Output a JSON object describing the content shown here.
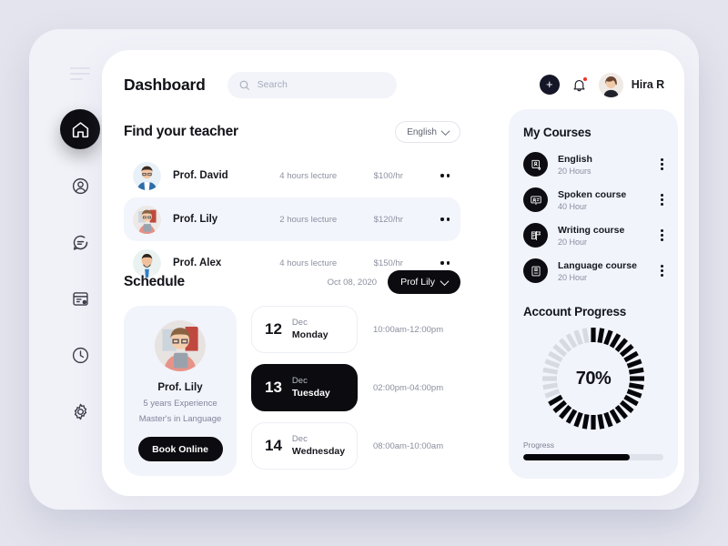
{
  "sidebar": {
    "items": [
      {
        "name": "menu-toggle",
        "icon": "hamburger-icon"
      },
      {
        "name": "home",
        "icon": "home-icon",
        "active": true
      },
      {
        "name": "profile",
        "icon": "user-icon",
        "active": false
      },
      {
        "name": "messages",
        "icon": "chat-icon",
        "active": false
      },
      {
        "name": "documents",
        "icon": "document-icon",
        "active": false
      },
      {
        "name": "history",
        "icon": "clock-icon",
        "active": false
      },
      {
        "name": "settings",
        "icon": "gear-icon",
        "active": false
      }
    ]
  },
  "header": {
    "title": "Dashboard",
    "search": {
      "placeholder": "Search",
      "value": "",
      "icon": "search-icon"
    },
    "add_button_label": "+",
    "bell_icon": "bell-icon",
    "user_name": "Hira R"
  },
  "find_teacher": {
    "title": "Find your teacher",
    "language_filter": {
      "label": "English",
      "icon": "chevron-down-icon"
    },
    "teachers": [
      {
        "name": "Prof. David",
        "hours": "4 hours lecture",
        "price": "$100/hr",
        "selected": false
      },
      {
        "name": "Prof. Lily",
        "hours": "2 hours lecture",
        "price": "$120/hr",
        "selected": true
      },
      {
        "name": "Prof. Alex",
        "hours": "4 hours lecture",
        "price": "$150/hr",
        "selected": false
      }
    ]
  },
  "schedule": {
    "title": "Schedule",
    "date": "Oct 08, 2020",
    "teacher_filter": {
      "label": "Prof Lily",
      "icon": "chevron-down-icon"
    },
    "teacher_card": {
      "name": "Prof. Lily",
      "experience": "5 years Experience",
      "degree": "Master's in Language",
      "book_label": "Book Online"
    },
    "slots": [
      {
        "day": "12",
        "month": "Dec",
        "weekday": "Monday",
        "time": "10:00am-12:00pm",
        "active": false
      },
      {
        "day": "13",
        "month": "Dec",
        "weekday": "Tuesday",
        "time": "02:00pm-04:00pm",
        "active": true
      },
      {
        "day": "14",
        "month": "Dec",
        "weekday": "Wednesday",
        "time": "08:00am-10:00am",
        "active": false
      }
    ]
  },
  "my_courses": {
    "title": "My Courses",
    "items": [
      {
        "name": "English",
        "hours": "20 Hours",
        "icon": "certificate-icon"
      },
      {
        "name": "Spoken course",
        "hours": "40 Hour",
        "icon": "presentation-icon"
      },
      {
        "name": "Writing course",
        "hours": "20 Hour",
        "icon": "book-flag-icon"
      },
      {
        "name": "Language course",
        "hours": "20 Hour",
        "icon": "bookmark-book-icon"
      }
    ]
  },
  "account_progress": {
    "title": "Account Progress",
    "ring_value": "70%",
    "ring_percent": 70,
    "bar_label": "Progress",
    "bar_percent": 76
  },
  "colors": {
    "page_background": "#e3e4ed",
    "shell_background": "#f1f2f8",
    "card_background": "#ffffff",
    "panel_background": "#f1f4fb",
    "accent_dark": "#0b0b10",
    "selected_row": "#f2f5fb",
    "muted_text": "#8a8e9d",
    "notification_dot": "#ef3124"
  }
}
